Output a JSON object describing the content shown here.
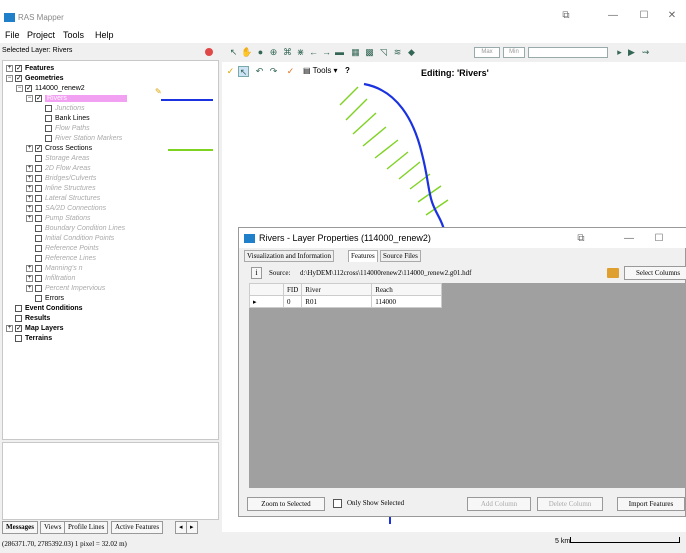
{
  "window": {
    "title": "RAS Mapper",
    "buttons": [
      "⧉",
      "—",
      "☐",
      "✕"
    ]
  },
  "menu": [
    "File",
    "Project",
    "Tools",
    "Help"
  ],
  "selected_layer": "Selected Layer: Rivers",
  "toolbar": {
    "max_label": "Max",
    "min_label": "Min"
  },
  "tree": [
    {
      "label": "Features",
      "indent": 0,
      "exp": "+",
      "check": true,
      "style": "bold"
    },
    {
      "label": "Geometries",
      "indent": 0,
      "exp": "−",
      "check": true,
      "style": "bold"
    },
    {
      "label": "114000_renew2",
      "indent": 1,
      "exp": "−",
      "check": true,
      "style": ""
    },
    {
      "label": "Rivers",
      "indent": 2,
      "exp": "−",
      "check": true,
      "style": "selected"
    },
    {
      "label": "Junctions",
      "indent": 3,
      "exp": "",
      "check": false,
      "style": "dim"
    },
    {
      "label": "Bank Lines",
      "indent": 3,
      "exp": "",
      "check": false,
      "style": ""
    },
    {
      "label": "Flow Paths",
      "indent": 3,
      "exp": "",
      "check": false,
      "style": "dim"
    },
    {
      "label": "River Station Markers",
      "indent": 3,
      "exp": "",
      "check": false,
      "style": "dim"
    },
    {
      "label": "Cross Sections",
      "indent": 2,
      "exp": "+",
      "check": true,
      "style": ""
    },
    {
      "label": "Storage Areas",
      "indent": 2,
      "exp": "",
      "check": false,
      "style": "dim"
    },
    {
      "label": "2D Flow Areas",
      "indent": 2,
      "exp": "+",
      "check": false,
      "style": "dim"
    },
    {
      "label": "Bridges/Culverts",
      "indent": 2,
      "exp": "+",
      "check": false,
      "style": "dim"
    },
    {
      "label": "Inline Structures",
      "indent": 2,
      "exp": "+",
      "check": false,
      "style": "dim"
    },
    {
      "label": "Lateral Structures",
      "indent": 2,
      "exp": "+",
      "check": false,
      "style": "dim"
    },
    {
      "label": "SA/2D Connections",
      "indent": 2,
      "exp": "+",
      "check": false,
      "style": "dim"
    },
    {
      "label": "Pump Stations",
      "indent": 2,
      "exp": "+",
      "check": false,
      "style": "dim"
    },
    {
      "label": "Boundary Condition Lines",
      "indent": 2,
      "exp": "",
      "check": false,
      "style": "dim"
    },
    {
      "label": "Initial Condition Points",
      "indent": 2,
      "exp": "",
      "check": false,
      "style": "dim"
    },
    {
      "label": "Reference Points",
      "indent": 2,
      "exp": "",
      "check": false,
      "style": "dim"
    },
    {
      "label": "Reference Lines",
      "indent": 2,
      "exp": "",
      "check": false,
      "style": "dim"
    },
    {
      "label": "Manning's n",
      "indent": 2,
      "exp": "+",
      "check": false,
      "style": "dim"
    },
    {
      "label": "Infiltration",
      "indent": 2,
      "exp": "+",
      "check": false,
      "style": "dim"
    },
    {
      "label": "Percent Impervious",
      "indent": 2,
      "exp": "+",
      "check": false,
      "style": "dim"
    },
    {
      "label": "Errors",
      "indent": 2,
      "exp": "",
      "check": false,
      "style": ""
    },
    {
      "label": "Event Conditions",
      "indent": 0,
      "exp": "",
      "check": false,
      "style": "bold"
    },
    {
      "label": "Results",
      "indent": 0,
      "exp": "",
      "check": false,
      "style": "bold"
    },
    {
      "label": "Map Layers",
      "indent": 0,
      "exp": "+",
      "check": true,
      "style": "bold"
    },
    {
      "label": "Terrains",
      "indent": 0,
      "exp": "",
      "check": false,
      "style": "bold"
    }
  ],
  "bottom_tabs": [
    "Messages",
    "Views",
    "Profile Lines",
    "Active Features"
  ],
  "status": {
    "coords": "(286371.70, 2785392.03)  1 pixel = 32.02 m)",
    "scale": "5 km"
  },
  "edit_toolbar": {
    "tools_label": "Tools",
    "help_label": "?"
  },
  "editing_label": "Editing: 'Rivers'",
  "dialog": {
    "title": "Rivers - Layer Properties (114000_renew2)",
    "tabs": [
      "Visualization and Information",
      "Features",
      "Source Files"
    ],
    "active_tab": "Features",
    "info_button": "i",
    "source_label": "Source:",
    "source_path": "d:\\HyDEM\\112cross\\114000renew2\\114000_renew2.g01.hdf",
    "select_columns_label": "Select Columns",
    "columns": [
      "",
      "FID",
      "River",
      "Reach"
    ],
    "rows": [
      [
        "▸",
        "0",
        "R01",
        "114000"
      ]
    ],
    "footer": {
      "zoom_selected": "Zoom to Selected",
      "only_show_selected": "Only Show Selected",
      "add_column": "Add Column",
      "delete_column": "Delete Column",
      "import_features": "Import Features"
    }
  }
}
